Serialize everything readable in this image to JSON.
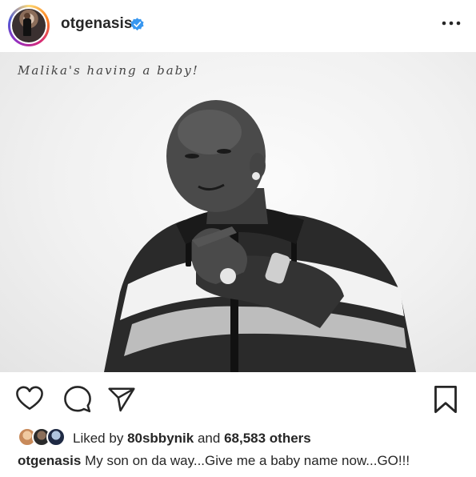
{
  "post": {
    "username": "otgenasis",
    "verified": true,
    "photo_overlay_text": "Malika's having a baby!",
    "likes": {
      "prefix": "Liked by",
      "first_liker": "80sbbynik",
      "joiner": "and",
      "others_count": "68,583 others"
    },
    "caption": {
      "username": "otgenasis",
      "text": "My son on da way...Give me a baby name now...GO!!!"
    }
  },
  "icons": {
    "more": "more-options-icon",
    "like": "heart-icon",
    "comment": "comment-icon",
    "share": "share-icon",
    "save": "bookmark-icon",
    "verified": "verified-badge-icon"
  },
  "colors": {
    "text": "#262626",
    "verified_blue": "#3897f0",
    "background": "#ffffff"
  }
}
